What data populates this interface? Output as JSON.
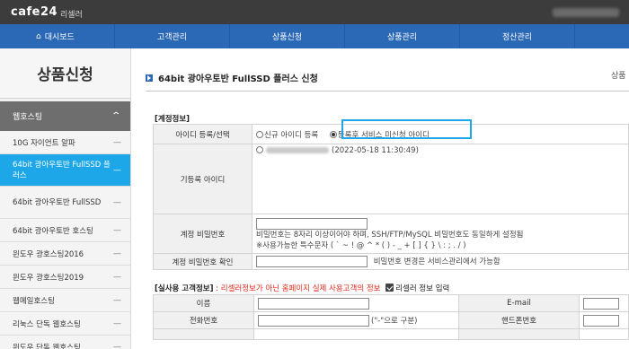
{
  "topbar": {
    "logo": "cafe24",
    "subtitle": "리셀러"
  },
  "nav": {
    "items": [
      "대시보드",
      "고객관리",
      "상품신청",
      "상품관리",
      "정산관리"
    ]
  },
  "sidebar": {
    "title": "상품신청",
    "section": "웹호스팅",
    "items": [
      "10G 자이언트 알파",
      "64bit 광아우토반 FullSSD 플러스",
      "64bit 광아우토반 FullSSD",
      "64bit 광아우토반 호스팅",
      "윈도우 광호스팅2016",
      "윈도우 광호스팅2019",
      "웹메일호스팅",
      "리눅스 단독 웹호스팅",
      "윈도우 단독 웹호스팅"
    ],
    "active_index": 1
  },
  "main": {
    "title": "64bit 광아우토반 FullSSD 플러스 신청",
    "breadcrumb": "상품",
    "account_section": "[계정정보]",
    "id_reg_label": "아이디 등록/선택",
    "opt_new": "신규 아이디 등록",
    "opt_existing": "등록후 서비스 미신청 아이디",
    "existing_id_label": "기등록 아이디",
    "existing_id_date": "(2022-05-18 11:30:49)",
    "pw_label": "계정 비밀번호",
    "pw_help1": "비밀번호는 8자리 이상이어야 하며, SSH/FTP/MySQL 비밀번호도 동일하게 설정됨",
    "pw_help2": "※사용가능한 특수문자 ( ` ~ ! @ ^ * ( ) - _ + [ ] { } \\ : ; . / )",
    "pw_confirm_label": "계정 비밀번호 확인",
    "pw_confirm_help": "비밀번호 변경은 서비스관리에서 가능함",
    "customer_section": "[실사용 고객정보]",
    "customer_note": " : 리셀러정보가 아닌 홈페이지 실제 사용고객의 정보",
    "reseller_check": "리셀러 정보 입력",
    "name_label": "이름",
    "email_label": "E-mail",
    "phone_label": "전화번호",
    "phone_hint": "(\"-\"으로 구분)",
    "mobile_label": "핸드폰번호"
  }
}
